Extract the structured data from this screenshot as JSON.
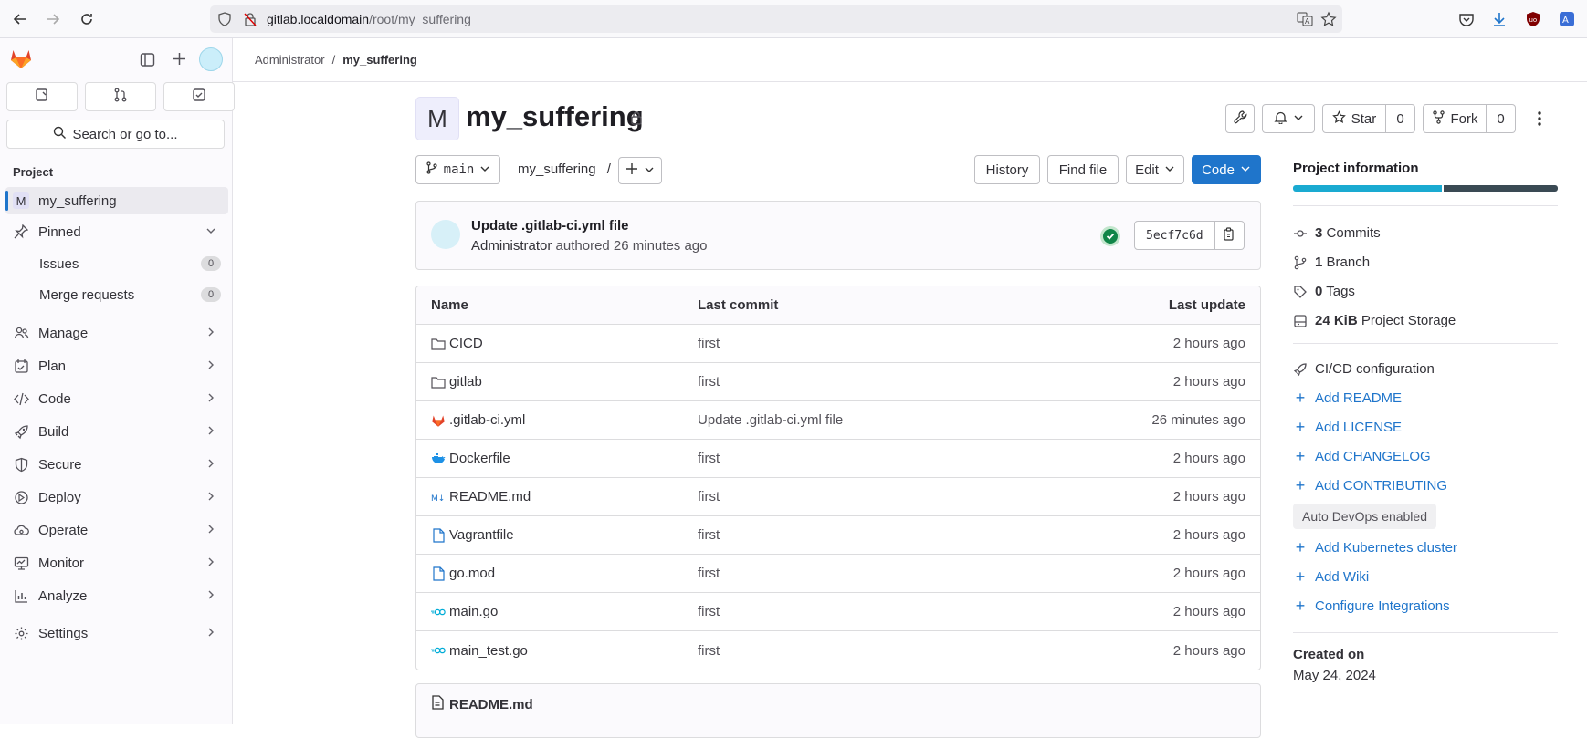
{
  "browser": {
    "url_host": "gitlab.localdomain",
    "url_path": "/root/my_suffering"
  },
  "sidebar": {
    "search_label": "Search or go to...",
    "section_label": "Project",
    "project_initial": "M",
    "project_name": "my_suffering",
    "pinned_label": "Pinned",
    "pinned_items": [
      {
        "label": "Issues",
        "count": "0"
      },
      {
        "label": "Merge requests",
        "count": "0"
      }
    ],
    "nav_items": [
      {
        "label": "Manage",
        "icon": "users-icon"
      },
      {
        "label": "Plan",
        "icon": "planning-icon"
      },
      {
        "label": "Code",
        "icon": "code-icon"
      },
      {
        "label": "Build",
        "icon": "rocket-icon"
      },
      {
        "label": "Secure",
        "icon": "shield-icon"
      },
      {
        "label": "Deploy",
        "icon": "deployments-icon"
      },
      {
        "label": "Operate",
        "icon": "cloud-gear-icon"
      },
      {
        "label": "Monitor",
        "icon": "monitor-icon"
      },
      {
        "label": "Analyze",
        "icon": "chart-icon"
      },
      {
        "label": "Settings",
        "icon": "gear-icon"
      }
    ]
  },
  "breadcrumb": {
    "parent": "Administrator",
    "separator": "/",
    "current": "my_suffering"
  },
  "project": {
    "initial": "M",
    "title": "my_suffering",
    "star_label": "Star",
    "star_count": "0",
    "fork_label": "Fork",
    "fork_count": "0"
  },
  "toolbar": {
    "branch": "main",
    "path": "my_suffering",
    "path_sep": "/",
    "history": "History",
    "find_file": "Find file",
    "edit": "Edit",
    "code": "Code"
  },
  "commit": {
    "title": "Update .gitlab-ci.yml file",
    "author": "Administrator",
    "meta": "authored 26 minutes ago",
    "sha": "5ecf7c6d"
  },
  "files": {
    "headers": {
      "name": "Name",
      "last_commit": "Last commit",
      "last_update": "Last update"
    },
    "rows": [
      {
        "name": "CICD",
        "type": "folder",
        "commit": "first",
        "date": "2 hours ago"
      },
      {
        "name": "gitlab",
        "type": "folder",
        "commit": "first",
        "date": "2 hours ago"
      },
      {
        "name": ".gitlab-ci.yml",
        "type": "gitlab",
        "commit": "Update .gitlab-ci.yml file",
        "date": "26 minutes ago"
      },
      {
        "name": "Dockerfile",
        "type": "docker",
        "commit": "first",
        "date": "2 hours ago"
      },
      {
        "name": "README.md",
        "type": "markdown",
        "commit": "first",
        "date": "2 hours ago"
      },
      {
        "name": "Vagrantfile",
        "type": "file",
        "commit": "first",
        "date": "2 hours ago"
      },
      {
        "name": "go.mod",
        "type": "file",
        "commit": "first",
        "date": "2 hours ago"
      },
      {
        "name": "main.go",
        "type": "go",
        "commit": "first",
        "date": "2 hours ago"
      },
      {
        "name": "main_test.go",
        "type": "go",
        "commit": "first",
        "date": "2 hours ago"
      }
    ]
  },
  "readme": {
    "title": "README.md"
  },
  "info": {
    "title": "Project information",
    "stats": [
      {
        "icon": "commit-icon",
        "value": "3",
        "label": "Commits"
      },
      {
        "icon": "branch-icon",
        "value": "1",
        "label": "Branch"
      },
      {
        "icon": "tag-icon",
        "value": "0",
        "label": "Tags"
      },
      {
        "icon": "storage-icon",
        "value": "24 KiB",
        "label": "Project Storage"
      }
    ],
    "cicd": "CI/CD configuration",
    "links1": [
      "Add README",
      "Add LICENSE",
      "Add CHANGELOG",
      "Add CONTRIBUTING"
    ],
    "devops": "Auto DevOps enabled",
    "links2": [
      "Add Kubernetes cluster",
      "Add Wiki",
      "Configure Integrations"
    ],
    "created_label": "Created on",
    "created_value": "May 24, 2024"
  },
  "colors": {
    "accent": "#1f75cb",
    "language_bar": [
      "#1aaad1",
      "#3a4a54"
    ],
    "success": "#108548"
  }
}
